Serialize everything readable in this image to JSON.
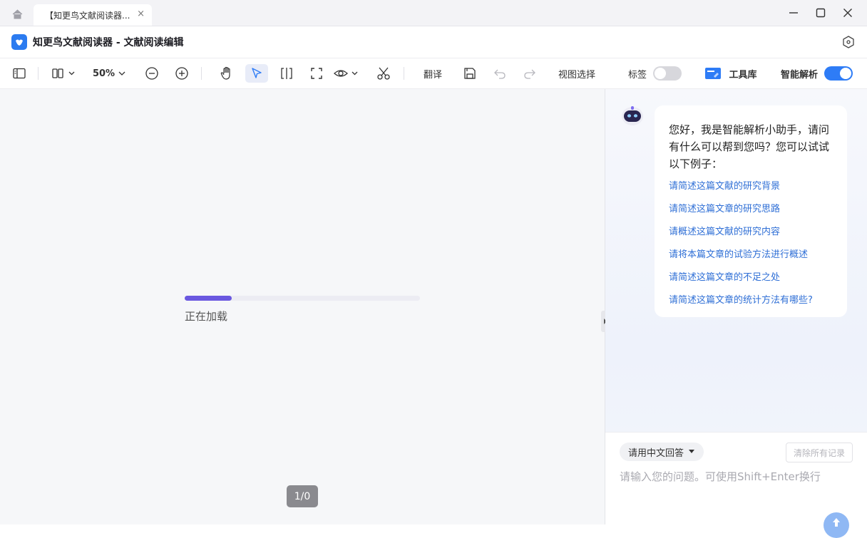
{
  "tabbar": {
    "tab_title": "【知更鸟文献阅读器...",
    "close_glyph": "×"
  },
  "app": {
    "title": "知更鸟文献阅读器 - 文献阅读编辑"
  },
  "toolbar": {
    "zoom": "50%",
    "translate_label": "翻译",
    "view_select_label": "视图选择",
    "tag_label": "标签",
    "tag_toggle": "off",
    "toolbox_label": "工具库",
    "smart_parse_label": "智能解析",
    "smart_parse_toggle": "on"
  },
  "reader": {
    "loading_text": "正在加载",
    "progress": 0.2,
    "page_indicator": "1/0"
  },
  "assistant": {
    "greeting": "您好，我是智能解析小助手，请问有什么可以帮到您吗？您可以试试以下例子：",
    "suggestions": [
      "请简述这篇文献的研究背景",
      "请简述这篇文章的研究思路",
      "请概述这篇文献的研究内容",
      "请将本篇文章的试验方法进行概述",
      "请简述这篇文章的不足之处",
      "请简述这篇文章的统计方法有哪些?"
    ],
    "language_select": "请用中文回答",
    "clear_history": "清除所有记录",
    "input_placeholder": "请输入您的问题。可使用Shift+Enter换行"
  },
  "colors": {
    "accent": "#2e7cf6",
    "progress": "#6a58e0",
    "link": "#2f6fd6"
  }
}
